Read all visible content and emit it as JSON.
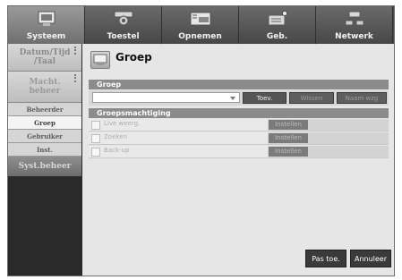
{
  "tabs": [
    {
      "label": "Systeem",
      "icon": "system-icon",
      "active": true
    },
    {
      "label": "Toestel",
      "icon": "camera-icon",
      "active": false
    },
    {
      "label": "Opnemen",
      "icon": "recorder-icon",
      "active": false
    },
    {
      "label": "Geb.",
      "icon": "event-icon",
      "active": false
    },
    {
      "label": "Netwerk",
      "icon": "network-icon",
      "active": false
    }
  ],
  "sidebar": {
    "datetime_label": "Datum/Tijd /Taal",
    "mgmt_label": "Macht. beheer",
    "sub_items": [
      "Beheerder",
      "Groep",
      "Gebruiker",
      "Inst."
    ],
    "active_sub": "Groep",
    "syst_label": "Syst.beheer"
  },
  "page": {
    "title": "Groep",
    "icon": "group-icon"
  },
  "group_section": {
    "header": "Groep",
    "select_value": "",
    "add_label": "Toev.",
    "remove_label": "Wissen",
    "rename_label": "Naam wzg"
  },
  "perm_section": {
    "header": "Groepsmachtiging",
    "items": [
      {
        "label": "Live weerg.",
        "button": "Instellen"
      },
      {
        "label": "Zoeken",
        "button": "Instellen"
      },
      {
        "label": "Back-up",
        "button": "Instellen"
      }
    ]
  },
  "footer": {
    "apply_label": "Pas toe.",
    "cancel_label": "Annuleer"
  }
}
